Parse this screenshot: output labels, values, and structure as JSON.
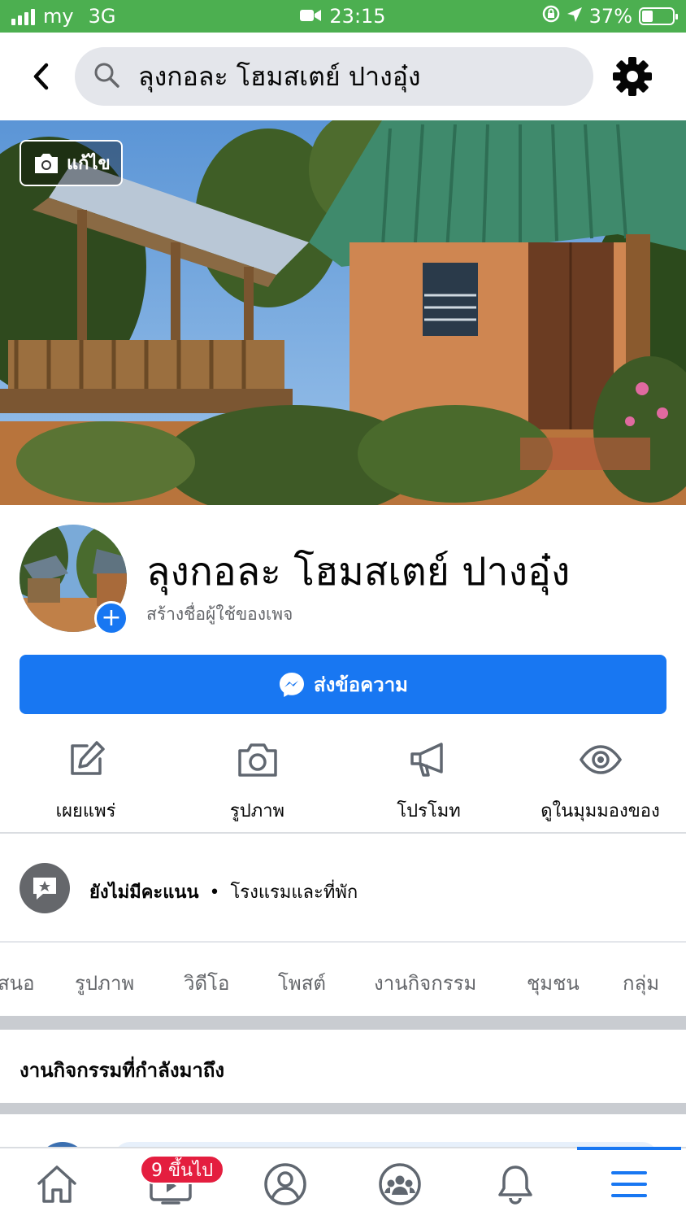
{
  "status_bar": {
    "carrier": "my",
    "network": "3G",
    "time": "23:15",
    "battery_percent": "37%",
    "battery_level": 0.37
  },
  "search": {
    "query": "ลุงกอละ โฮมสเตย์ ปางอุ๋ง"
  },
  "cover": {
    "edit_label": "แก้ไข"
  },
  "profile": {
    "name": "ลุงกอละ โฮมสเตย์ ปางอุ๋ง",
    "create_username": "สร้างชื่อผู้ใช้ของเพจ"
  },
  "message_button": {
    "label": "ส่งข้อความ"
  },
  "actions": [
    {
      "label": "เผยแพร่",
      "icon": "edit-icon"
    },
    {
      "label": "รูปภาพ",
      "icon": "camera-icon"
    },
    {
      "label": "โปรโมท",
      "icon": "megaphone-icon"
    },
    {
      "label": "ดูในมุมมองของ",
      "icon": "eye-icon"
    }
  ],
  "rating": {
    "status": "ยังไม่มีคะแนน",
    "separator": "•",
    "category": "โรงแรมและที่พัก"
  },
  "tabs": [
    "ข้อเสนอ",
    "รูปภาพ",
    "วิดีโอ",
    "โพสต์",
    "งานกิจกรรม",
    "ชุมชน",
    "กลุ่ม"
  ],
  "events": {
    "title": "งานกิจกรรมที่กำลังมาถึง"
  },
  "bottom_nav": {
    "badge": "9 ขึ้นไป",
    "items": [
      "home-icon",
      "watch-icon",
      "profile-icon",
      "groups-icon",
      "bell-icon",
      "menu-icon"
    ],
    "active": "menu-icon"
  },
  "colors": {
    "status_bar": "#4caf50",
    "accent": "#1877f2",
    "badge": "#e41e3f"
  }
}
